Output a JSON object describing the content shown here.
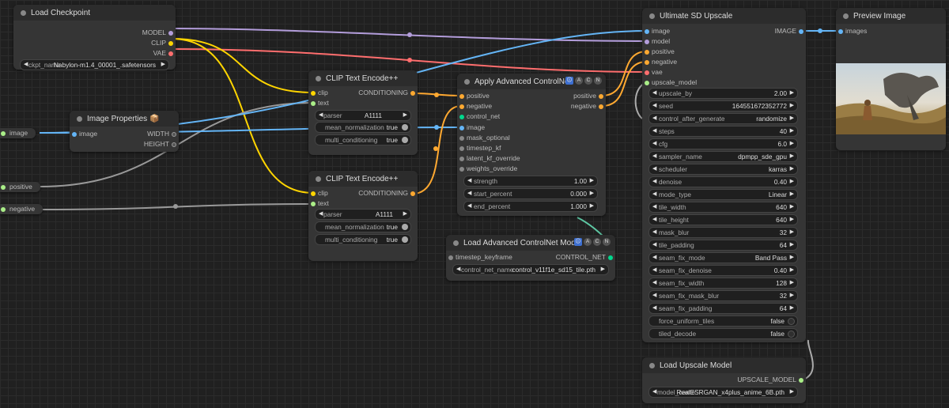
{
  "colors": {
    "model": "#b39ddb",
    "clip": "#ffd500",
    "vae": "#ff6e6e",
    "conditioning": "#ffa931",
    "image": "#64b5f6",
    "control_net": "#00d78d",
    "upscale_model": "#aaee88",
    "generic": "#aaaaaa"
  },
  "load_checkpoint": {
    "title": "Load Checkpoint",
    "outputs": [
      "MODEL",
      "CLIP",
      "VAE"
    ],
    "ckpt_label": "ckpt_name",
    "ckpt_value": "Nabylon-m1.4_00001_.safetensors"
  },
  "image_properties": {
    "title": "Image Properties",
    "emoji": "📦",
    "input": "image",
    "outputs": [
      "WIDTH",
      "HEIGHT"
    ]
  },
  "primitives": {
    "image": "image",
    "positive": "positive",
    "negative": "negative"
  },
  "clip_encode_1": {
    "title": "CLIP Text Encode++",
    "inputs": [
      "clip",
      "text"
    ],
    "output": "CONDITIONING",
    "parser_label": "parser",
    "parser_value": "A1111",
    "mean_label": "mean_normalization",
    "mean_value": "true",
    "multi_label": "multi_conditioning",
    "multi_value": "true"
  },
  "clip_encode_2": {
    "title": "CLIP Text Encode++",
    "inputs": [
      "clip",
      "text"
    ],
    "output": "CONDITIONING",
    "parser_label": "parser",
    "parser_value": "A1111",
    "mean_label": "mean_normalization",
    "mean_value": "true",
    "multi_label": "multi_conditioning",
    "multi_value": "true"
  },
  "apply_controlnet": {
    "title": "Apply Advanced ControlNet",
    "inputs": [
      "positive",
      "negative",
      "control_net",
      "image",
      "mask_optional",
      "timestep_kf",
      "latent_kf_override",
      "weights_override"
    ],
    "outputs": [
      "positive",
      "negative"
    ],
    "widgets": [
      {
        "label": "strength",
        "value": "1.00"
      },
      {
        "label": "start_percent",
        "value": "0.000"
      },
      {
        "label": "end_percent",
        "value": "1.000"
      }
    ]
  },
  "load_controlnet": {
    "title": "Load Advanced ControlNet Model",
    "input": "timestep_keyframe",
    "output": "CONTROL_NET",
    "name_label": "control_net_name",
    "name_value": "control_v11f1e_sd15_tile.pth"
  },
  "ultimate_upscale": {
    "title": "Ultimate SD Upscale",
    "inputs": [
      "image",
      "model",
      "positive",
      "negative",
      "vae",
      "upscale_model"
    ],
    "output": "IMAGE",
    "widgets": [
      {
        "label": "upscale_by",
        "value": "2.00"
      },
      {
        "label": "seed",
        "value": "164551672352772"
      },
      {
        "label": "control_after_generate",
        "value": "randomize"
      },
      {
        "label": "steps",
        "value": "40"
      },
      {
        "label": "cfg",
        "value": "6.0"
      },
      {
        "label": "sampler_name",
        "value": "dpmpp_sde_gpu"
      },
      {
        "label": "scheduler",
        "value": "karras"
      },
      {
        "label": "denoise",
        "value": "0.40"
      },
      {
        "label": "mode_type",
        "value": "Linear"
      },
      {
        "label": "tile_width",
        "value": "640"
      },
      {
        "label": "tile_height",
        "value": "640"
      },
      {
        "label": "mask_blur",
        "value": "32"
      },
      {
        "label": "tile_padding",
        "value": "64"
      },
      {
        "label": "seam_fix_mode",
        "value": "Band Pass"
      },
      {
        "label": "seam_fix_denoise",
        "value": "0.40"
      },
      {
        "label": "seam_fix_width",
        "value": "128"
      },
      {
        "label": "seam_fix_mask_blur",
        "value": "32"
      },
      {
        "label": "seam_fix_padding",
        "value": "64"
      }
    ],
    "toggles": [
      {
        "label": "force_uniform_tiles",
        "value": "false"
      },
      {
        "label": "tiled_decode",
        "value": "false"
      }
    ]
  },
  "load_upscale": {
    "title": "Load Upscale Model",
    "output": "UPSCALE_MODEL",
    "name_label": "model_name",
    "name_value": "RealESRGAN_x4plus_anime_6B.pth"
  },
  "preview": {
    "title": "Preview Image",
    "input": "images"
  }
}
